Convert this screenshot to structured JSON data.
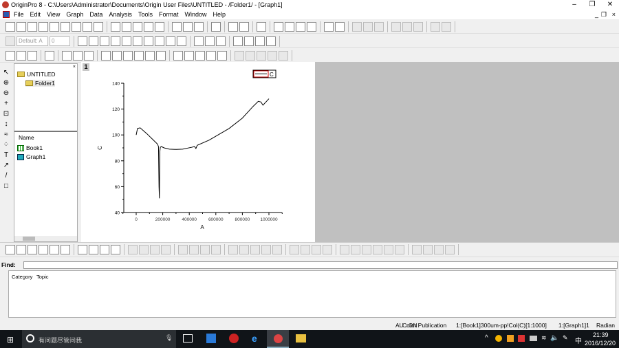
{
  "window": {
    "title": "OriginPro 8 - C:\\Users\\Administrator\\Documents\\Origin User Files\\UNTITLED - /Folder1/ - [Graph1]"
  },
  "menu": [
    "File",
    "Edit",
    "View",
    "Graph",
    "Data",
    "Analysis",
    "Tools",
    "Format",
    "Window",
    "Help"
  ],
  "format_toolbar": {
    "font": "Default: A",
    "size": "0",
    "line_width": "0",
    "border_width": "0"
  },
  "explorer": {
    "root": "UNTITLED",
    "folder": "Folder1",
    "column_header": "Name",
    "items": [
      "Book1",
      "Graph1"
    ]
  },
  "graph": {
    "page_number": "1",
    "legend": "C"
  },
  "chart_data": {
    "type": "line",
    "xlabel": "A",
    "ylabel": "C",
    "xlim": [
      -100000,
      1100000
    ],
    "ylim": [
      40,
      140
    ],
    "xticks": [
      "0",
      "200000",
      "400000",
      "600000",
      "800000",
      "1000000"
    ],
    "yticks": [
      "40",
      "60",
      "80",
      "100",
      "120",
      "140"
    ],
    "series": [
      {
        "name": "C",
        "color": "#000000",
        "x": [
          0,
          10000,
          30000,
          80000,
          120000,
          160000,
          168000,
          172000,
          175000,
          178000,
          182000,
          190000,
          210000,
          250000,
          300000,
          350000,
          420000,
          440000,
          450000,
          460000,
          550000,
          700000,
          800000,
          880000,
          920000,
          940000,
          955000,
          1000000
        ],
        "y": [
          100,
          105,
          105.5,
          101,
          97,
          93,
          91,
          60,
          51,
          87,
          90.5,
          91,
          90,
          89,
          88.8,
          89,
          90.5,
          91,
          89.5,
          92,
          96,
          105,
          113,
          122,
          126,
          125.5,
          123,
          128
        ]
      }
    ]
  },
  "find": {
    "label": "Find:",
    "tabs": [
      "Category",
      "Topic"
    ]
  },
  "status": {
    "au": "AU : ON",
    "theme": "Color Publication",
    "column": "1:[Book1]300um-pp!Col(C)[1:1000]",
    "layer": "1:[Graph1]1",
    "angle": "Radian"
  },
  "taskbar": {
    "search_placeholder": "有问题尽管问我",
    "time": "21:39",
    "date": "2016/12/20",
    "ime": "中"
  }
}
